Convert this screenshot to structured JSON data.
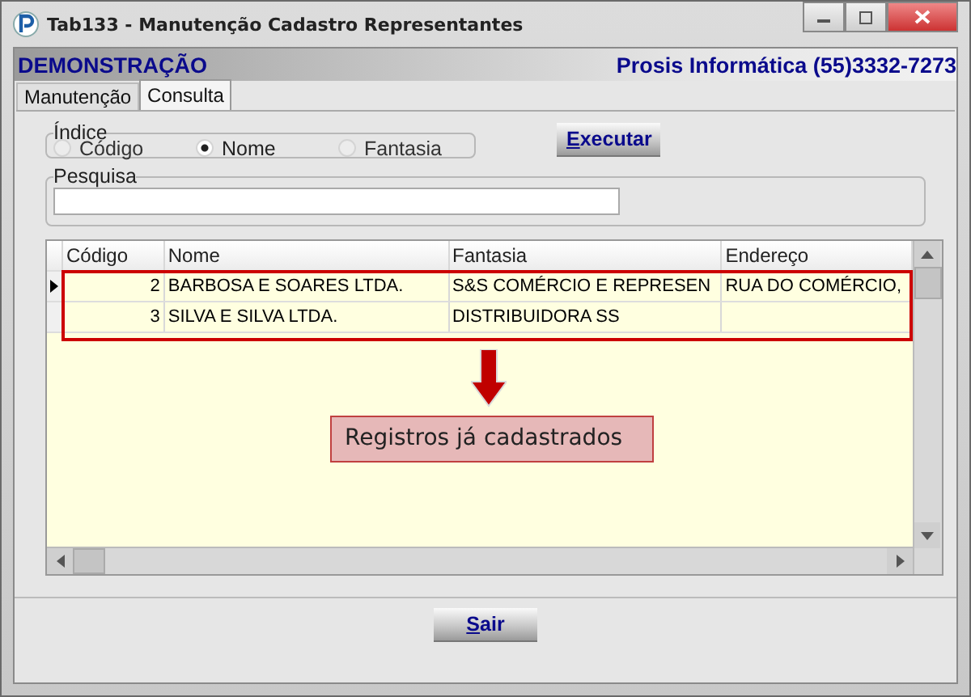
{
  "window": {
    "title": "Tab133 - Manutenção Cadastro Representantes"
  },
  "header": {
    "left": "DEMONSTRAÇÃO",
    "right": "Prosis Informática (55)3332-7273"
  },
  "tabs": [
    {
      "label": "Manutenção",
      "selected": false
    },
    {
      "label": "Consulta",
      "selected": true
    }
  ],
  "indice": {
    "legend": "Índice",
    "options": [
      {
        "label": "Código",
        "selected": false
      },
      {
        "label": "Nome",
        "selected": true
      },
      {
        "label": "Fantasia",
        "selected": false
      }
    ]
  },
  "execute_button": "Executar",
  "search": {
    "legend": "Pesquisa"
  },
  "table": {
    "columns": [
      "Código",
      "Nome",
      "Fantasia",
      "Endereço"
    ],
    "rows": [
      {
        "selected": true,
        "cells": [
          "2",
          "BARBOSA E SOARES LTDA.",
          "S&S COMÉRCIO E REPRESEN",
          "RUA DO COMÉRCIO,"
        ]
      },
      {
        "selected": false,
        "cells": [
          "3",
          "SILVA E SILVA LTDA.",
          "DISTRIBUIDORA SS"
        ]
      }
    ]
  },
  "callout": "Registros já cadastrados",
  "exit_button": "Sair"
}
